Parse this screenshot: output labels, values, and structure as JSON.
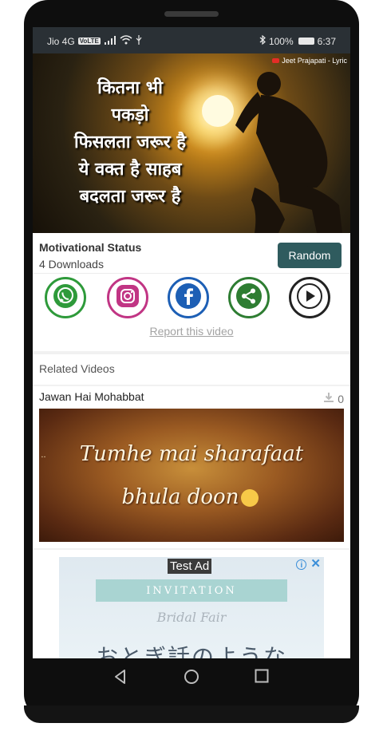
{
  "status_bar": {
    "carrier": "Jio 4G",
    "volte": "VoLTE",
    "battery": "100%",
    "time": "6:37"
  },
  "video": {
    "watermark": "Jeet Prajapati - Lyric",
    "quote_lines": [
      "कितना भी",
      "पकड़ो",
      "फिसलता जरूर है",
      "ये वक्त है साहब",
      "बदलता जरूर है"
    ]
  },
  "info": {
    "title": "Motivational Status",
    "downloads": "4 Downloads",
    "random_label": "Random",
    "report_label": "Report this video"
  },
  "share_buttons": [
    {
      "icon": "whatsapp-icon",
      "color": "#2e9a3a"
    },
    {
      "icon": "instagram-icon",
      "color": "#c13584"
    },
    {
      "icon": "facebook-icon",
      "color": "#1d5fb5"
    },
    {
      "icon": "share-icon",
      "color": "#2e7d32"
    },
    {
      "icon": "play-icon",
      "color": "#222222"
    }
  ],
  "related": {
    "heading": "Related Videos",
    "items": [
      {
        "title": "Jawan Hai Mohabbat",
        "count": "0",
        "thumb_line1": "Tumhe mai sharafaat",
        "thumb_line2": "bhula doon"
      }
    ]
  },
  "ad": {
    "label": "Test Ad",
    "ribbon": "INVITATION",
    "subtitle": "Bridal Fair",
    "japanese": "おとぎ話のような"
  }
}
